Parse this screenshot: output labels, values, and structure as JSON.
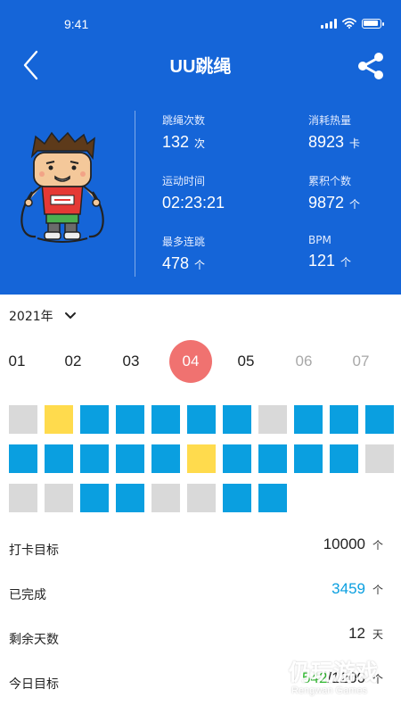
{
  "status_bar": {
    "time": "9:41"
  },
  "nav": {
    "title": "UU跳绳",
    "back_icon": "chevron-left-icon",
    "share_icon": "share-icon"
  },
  "colors": {
    "header_bg": "#1565d8",
    "selected_month": "#f07270",
    "done": "#0a9fe0",
    "highlight": "#ffdb4d",
    "empty": "#d9d9d9",
    "today_done": "#2db82d"
  },
  "stats": {
    "jump_count": {
      "label": "跳绳次数",
      "value": "132",
      "unit": "次"
    },
    "calories": {
      "label": "消耗热量",
      "value": "8923",
      "unit": "卡"
    },
    "duration": {
      "label": "运动时间",
      "value": "02:23:21"
    },
    "total": {
      "label": "累积个数",
      "value": "9872",
      "unit": "个"
    },
    "max_streak": {
      "label": "最多连跳",
      "value": "478",
      "unit": "个"
    },
    "bpm": {
      "label": "BPM",
      "value": "121",
      "unit": "个"
    }
  },
  "calendar": {
    "year": "2021年",
    "months": [
      {
        "label": "01",
        "state": "normal"
      },
      {
        "label": "02",
        "state": "normal"
      },
      {
        "label": "03",
        "state": "normal"
      },
      {
        "label": "04",
        "state": "selected"
      },
      {
        "label": "05",
        "state": "normal"
      },
      {
        "label": "06",
        "state": "dim"
      },
      {
        "label": "07",
        "state": "dim"
      }
    ],
    "days": [
      "empty",
      "highlight",
      "done",
      "done",
      "done",
      "done",
      "done",
      "empty",
      "done",
      "done",
      "done",
      "done",
      "done",
      "done",
      "done",
      "done",
      "highlight",
      "done",
      "done",
      "done",
      "done",
      "empty",
      "empty",
      "empty",
      "done",
      "done",
      "empty",
      "empty",
      "done",
      "done"
    ]
  },
  "goals": {
    "checkin_target": {
      "label": "打卡目标",
      "value": "10000",
      "unit": "个"
    },
    "completed": {
      "label": "已完成",
      "value": "3459",
      "unit": "个"
    },
    "days_left": {
      "label": "剩余天数",
      "value": "12",
      "unit": "天"
    },
    "today_target": {
      "label": "今日目标",
      "done": "542",
      "separator": "/",
      "total": "1200",
      "unit": "个"
    }
  },
  "watermark": {
    "text": "仍玩游戏",
    "sub": "Rengwan Games"
  }
}
